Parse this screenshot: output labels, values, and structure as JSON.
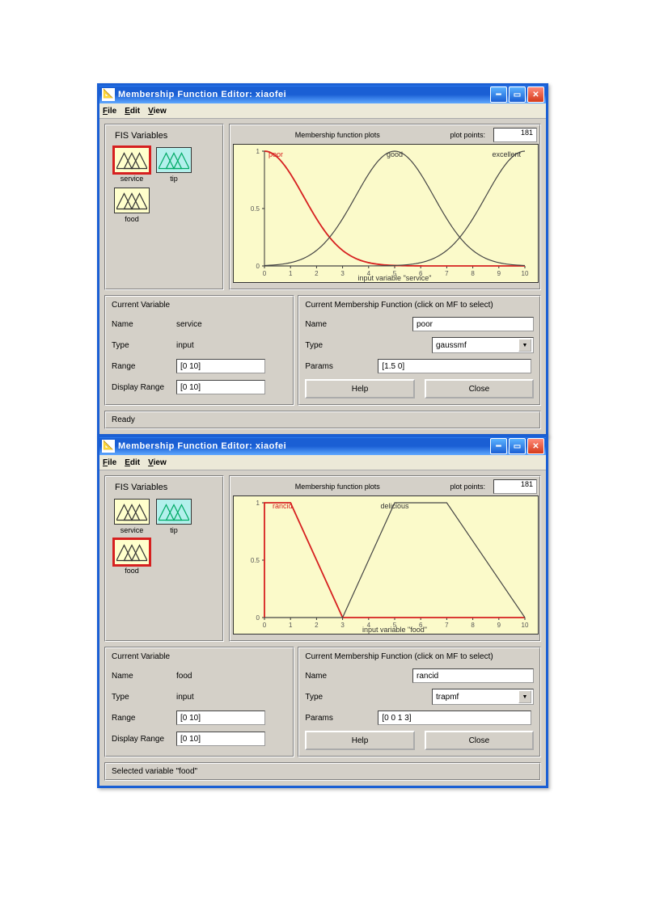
{
  "windows": [
    {
      "title": "Membership Function Editor: xiaofei",
      "menu": [
        "File",
        "Edit",
        "View"
      ],
      "fis_title": "FIS Variables",
      "fis_vars": [
        {
          "name": "service",
          "type": "input",
          "selected": true
        },
        {
          "name": "tip",
          "type": "output",
          "selected": false
        },
        {
          "name": "food",
          "type": "input",
          "selected": false
        }
      ],
      "plot_header": "Membership function plots",
      "plot_points_label": "plot points:",
      "plot_points": "181",
      "xaxis_label": "input variable \"service\"",
      "mf_labels": [
        "poor",
        "good",
        "excellent"
      ],
      "current_var": {
        "title": "Current Variable",
        "name_lbl": "Name",
        "name_val": "service",
        "type_lbl": "Type",
        "type_val": "input",
        "range_lbl": "Range",
        "range_val": "[0 10]",
        "disp_lbl": "Display Range",
        "disp_val": "[0 10]"
      },
      "current_mf": {
        "title": "Current Membership Function (click on MF to select)",
        "name_lbl": "Name",
        "name_val": "poor",
        "type_lbl": "Type",
        "type_val": "gaussmf",
        "params_lbl": "Params",
        "params_val": "[1.5 0]",
        "help_btn": "Help",
        "close_btn": "Close"
      },
      "status": "Ready",
      "chart_data": {
        "type": "line",
        "xlim": [
          0,
          10
        ],
        "ylim": [
          0,
          1
        ],
        "xticks": [
          0,
          1,
          2,
          3,
          4,
          5,
          6,
          7,
          8,
          9,
          10
        ],
        "yticks": [
          0,
          0.5,
          1
        ],
        "series": [
          {
            "name": "poor",
            "fn": "gaussmf",
            "sigma": 1.5,
            "c": 0,
            "selected": true
          },
          {
            "name": "good",
            "fn": "gaussmf",
            "sigma": 1.5,
            "c": 5,
            "selected": false
          },
          {
            "name": "excellent",
            "fn": "gaussmf",
            "sigma": 1.5,
            "c": 10,
            "selected": false
          }
        ]
      }
    },
    {
      "title": "Membership Function Editor: xiaofei",
      "menu": [
        "File",
        "Edit",
        "View"
      ],
      "fis_title": "FIS Variables",
      "fis_vars": [
        {
          "name": "service",
          "type": "input",
          "selected": false
        },
        {
          "name": "tip",
          "type": "output",
          "selected": false
        },
        {
          "name": "food",
          "type": "input",
          "selected": true
        }
      ],
      "plot_header": "Membership function plots",
      "plot_points_label": "plot points:",
      "plot_points": "181",
      "xaxis_label": "input variable \"food\"",
      "mf_labels": [
        "rancid",
        "delicious"
      ],
      "current_var": {
        "title": "Current Variable",
        "name_lbl": "Name",
        "name_val": "food",
        "type_lbl": "Type",
        "type_val": "input",
        "range_lbl": "Range",
        "range_val": "[0 10]",
        "disp_lbl": "Display Range",
        "disp_val": "[0 10]"
      },
      "current_mf": {
        "title": "Current Membership Function (click on MF to select)",
        "name_lbl": "Name",
        "name_val": "rancid",
        "type_lbl": "Type",
        "type_val": "trapmf",
        "params_lbl": "Params",
        "params_val": "[0 0 1 3]",
        "help_btn": "Help",
        "close_btn": "Close"
      },
      "status": "Selected variable \"food\"",
      "chart_data": {
        "type": "line",
        "xlim": [
          0,
          10
        ],
        "ylim": [
          0,
          1
        ],
        "xticks": [
          0,
          1,
          2,
          3,
          4,
          5,
          6,
          7,
          8,
          9,
          10
        ],
        "yticks": [
          0,
          0.5,
          1
        ],
        "series": [
          {
            "name": "rancid",
            "fn": "trapmf",
            "pts": [
              0,
              0,
              1,
              3
            ],
            "selected": true
          },
          {
            "name": "delicious",
            "fn": "trapmf",
            "pts": [
              3,
              5,
              7,
              10
            ],
            "selected": false
          }
        ]
      }
    }
  ]
}
